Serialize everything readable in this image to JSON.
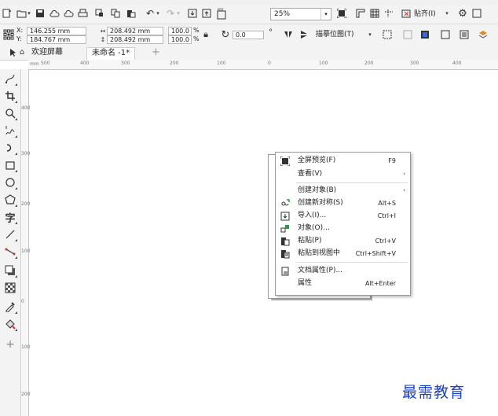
{
  "toolbar": {
    "zoom_value": "25%",
    "paste_label": "贴齐(I)",
    "trace_label": "描摹位图(T)"
  },
  "property_bar": {
    "x_label": "X:",
    "x_value": "146.255 mm",
    "y_label": "Y:",
    "y_value": "184.767 mm",
    "width_value": "208.492 mm",
    "height_value": "208.492 mm",
    "scale_x": "100.0",
    "scale_y": "100.0",
    "percent_symbol": "%",
    "rotation_value": "0.0",
    "degree_symbol": "°"
  },
  "tabs": [
    {
      "label": "欢迎屏幕"
    },
    {
      "label": "未命名 -1*"
    },
    {
      "label": "+"
    }
  ],
  "ruler": {
    "h_ticks": [
      "500",
      "400",
      "300",
      "200",
      "100",
      "0",
      "100",
      "200",
      "300",
      "400"
    ],
    "v_ticks": [
      "400",
      "300",
      "200",
      "100",
      "0",
      "100",
      "200"
    ],
    "unit": "mm"
  },
  "context_menu": {
    "items": [
      {
        "label": "全屏预览(F)",
        "shortcut": "F9",
        "icon": "fullscreen-icon"
      },
      {
        "label": "查看(V)",
        "submenu": true
      },
      {
        "label": "创建对象(B)",
        "submenu": true
      },
      {
        "label": "创建新对称(S)",
        "shortcut": "Alt+S",
        "icon": "symmetry-icon"
      },
      {
        "label": "导入(I)...",
        "shortcut": "Ctrl+I",
        "icon": "import-icon"
      },
      {
        "label": "对象(O)...",
        "icon": "object-icon"
      },
      {
        "label": "粘贴(P)",
        "shortcut": "Ctrl+V",
        "icon": "paste-icon"
      },
      {
        "label": "粘贴到视图中",
        "shortcut": "Ctrl+Shift+V",
        "icon": "paste-in-view-icon"
      },
      {
        "label": "文档属性(P)...",
        "icon": "document-properties-icon"
      },
      {
        "label": "属性",
        "shortcut": "Alt+Enter"
      }
    ],
    "submenu_arrow": "›"
  },
  "watermark": "最需教育",
  "colors": {
    "watermark": "#1a3fc8",
    "toolbar_bg": "#f3f3f3",
    "menu_border": "#999999"
  }
}
